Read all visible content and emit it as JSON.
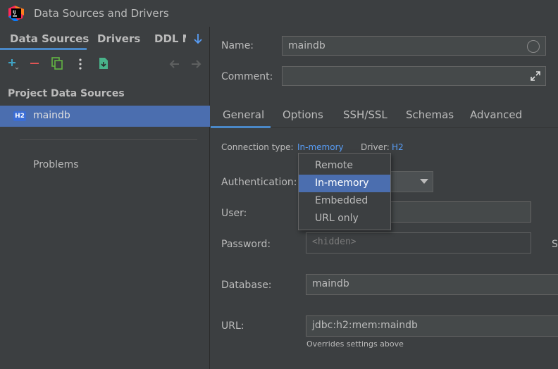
{
  "window": {
    "title": "Data Sources and Drivers",
    "logo": "intellij-logo"
  },
  "left_tabs": [
    "Data Sources",
    "Drivers",
    "DDL M"
  ],
  "toolbar": {
    "icons": [
      "add-icon",
      "remove-icon",
      "duplicate-icon",
      "more-icon",
      "import-icon",
      "back-icon",
      "forward-icon"
    ]
  },
  "sidebar": {
    "section_title": "Project Data Sources",
    "items": [
      {
        "badge": "H2",
        "label": "maindb"
      }
    ],
    "problems_label": "Problems"
  },
  "form": {
    "name_label": "Name:",
    "name_value": "maindb",
    "comment_label": "Comment:",
    "comment_value": ""
  },
  "tabs": [
    "General",
    "Options",
    "SSH/SSL",
    "Schemas",
    "Advanced"
  ],
  "general": {
    "connection_type_label": "Connection type:",
    "connection_type_value": "In-memory",
    "driver_label": "Driver:",
    "driver_value": "H2",
    "auth_label": "Authentication:",
    "user_label": "User:",
    "password_label": "Password:",
    "password_placeholder": "<hidden>",
    "password_side_partial": "S",
    "database_label": "Database:",
    "database_value": "maindb",
    "url_label": "URL:",
    "url_value": "jdbc:h2:mem:maindb",
    "url_hint": "Overrides settings above"
  },
  "connection_type_popup": {
    "options": [
      "Remote",
      "In-memory",
      "Embedded",
      "URL only"
    ],
    "selected": "In-memory"
  },
  "colors": {
    "accent": "#4a88c7",
    "selection": "#4b6eaf",
    "link": "#589df6",
    "background": "#3c3f41"
  }
}
